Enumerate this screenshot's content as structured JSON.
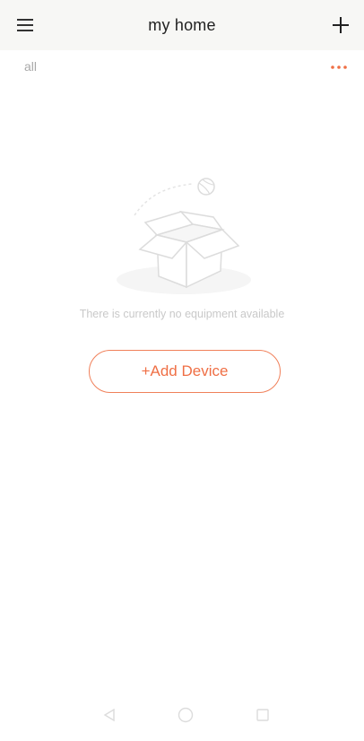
{
  "header": {
    "title": "my home",
    "menu_icon": "hamburger-menu-icon",
    "add_icon": "plus-icon"
  },
  "filter": {
    "selected_room": "all",
    "more_icon": "more-dots-icon"
  },
  "empty_state": {
    "illustration": "empty-box-illustration",
    "message": "There is currently no equipment available"
  },
  "actions": {
    "add_device_label": "+Add Device"
  },
  "nav": {
    "back_icon": "back-triangle-icon",
    "home_icon": "home-circle-icon",
    "recents_icon": "recents-square-icon"
  },
  "colors": {
    "accent": "#ef6f45",
    "header_bg": "#f7f7f5",
    "muted_text": "#a9a9a9"
  }
}
